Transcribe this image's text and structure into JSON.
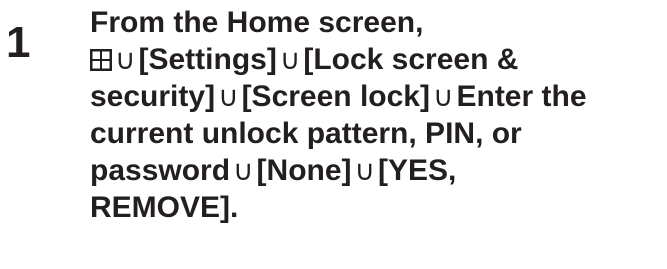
{
  "step": {
    "number": "1",
    "icon": "apps-grid-icon",
    "arrow": "∪",
    "line1": "From the Home screen,",
    "line2_a": "[Settings]",
    "line2_b": "[Lock screen &",
    "line3_a": "security]",
    "line3_b": "[Screen lock]",
    "line3_c": "Enter the",
    "line4": "current unlock pattern, PIN, or",
    "line5_a": "password",
    "line5_b": "[None]",
    "line5_c": "[YES,",
    "line6": "REMOVE].",
    "text_color": "#231f20",
    "icon_color": "#231f20"
  }
}
